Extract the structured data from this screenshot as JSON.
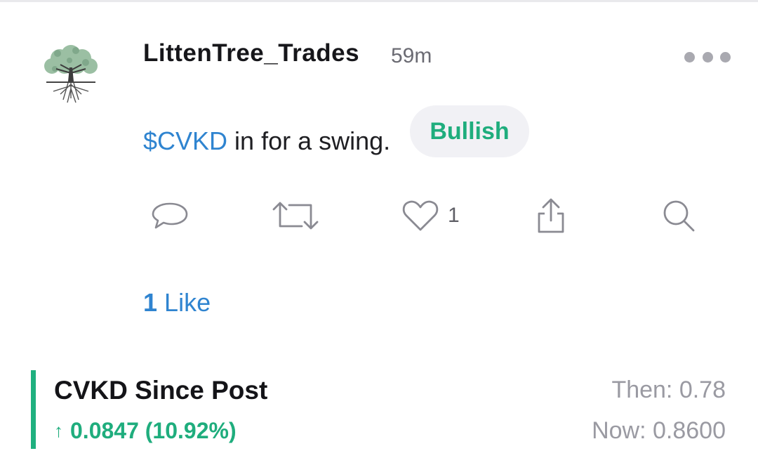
{
  "post": {
    "username": "LittenTree_Trades",
    "timestamp": "59m",
    "ticker": "$CVKD",
    "text_rest": " in for a swing.",
    "sentiment": "Bullish"
  },
  "actions": {
    "like_count": "1",
    "icons": [
      "comment-icon",
      "repost-icon",
      "heart-icon",
      "share-icon",
      "search-icon"
    ]
  },
  "likes_summary": {
    "count": "1",
    "label": "Like"
  },
  "since_post": {
    "title": "CVKD Since Post",
    "arrow": "↑",
    "change": "0.0847 (10.92%)",
    "then": "Then: 0.78",
    "now": "Now: 0.8600"
  },
  "colors": {
    "link": "#2f84d0",
    "bullish": "#1fad7d",
    "accent_bar": "#1fb07f",
    "muted": "#9a9aa2"
  }
}
